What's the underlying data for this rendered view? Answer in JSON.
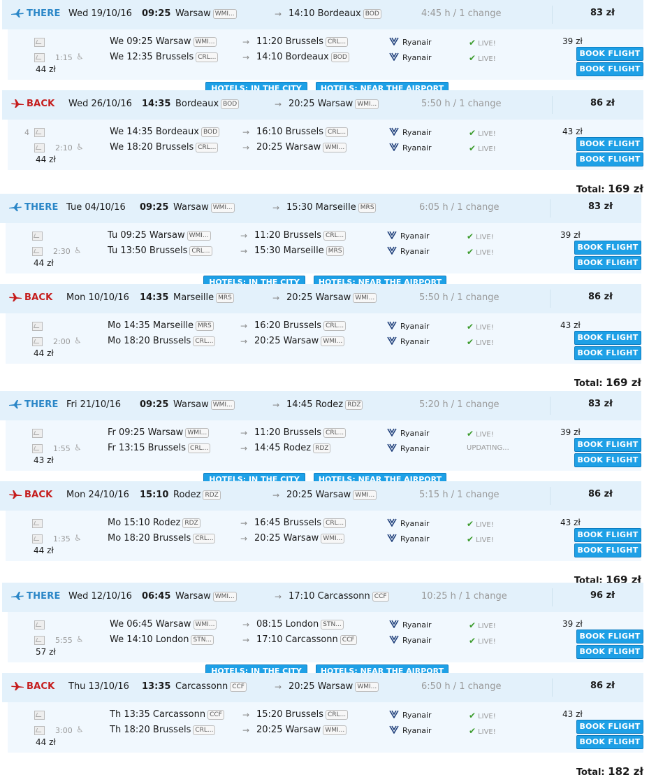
{
  "labels": {
    "there": "THERE",
    "back": "BACK",
    "book": "BOOK FLIGHT",
    "hotels_city": "HOTELS: IN THE CITY",
    "hotels_airport": "HOTELS: NEAR THE AIRPORT",
    "total": "Total:",
    "airline": "Ryanair"
  },
  "colors": {
    "accent": "#1ea0e6",
    "there": "#2a86c7",
    "back": "#c51d1d",
    "bar": "#e3f1fb",
    "live": "#3a9a2a"
  },
  "trips": [
    {
      "there": {
        "date": "Wed 19/10/16",
        "time": "09:25",
        "from": "Warsaw",
        "from_code": "WMI...",
        "arr": "14:10 Bordeaux",
        "arr_code": "BOD",
        "duration": "4:45 h / 1 change",
        "price": "83 zł",
        "seg1": {
          "dep": "We 09:25 Warsaw",
          "dep_code": "WMI...",
          "arr": "11:20 Brussels",
          "arr_code": "CRL...",
          "status": "LIVE!",
          "price": "39 zł"
        },
        "seg2": {
          "dep": "We 12:35 Brussels",
          "dep_code": "CRL...",
          "arr": "14:10 Bordeaux",
          "arr_code": "BOD",
          "status": "LIVE!"
        },
        "layover": "1:15",
        "side_price": "44 zł"
      },
      "back": {
        "date": "Wed 26/10/16",
        "time": "14:35",
        "from": "Bordeaux",
        "from_code": "BOD",
        "arr": "20:25 Warsaw",
        "arr_code": "WMI...",
        "duration": "5:50 h / 1 change",
        "price": "86 zł",
        "seg1": {
          "dep": "We 14:35 Bordeaux",
          "dep_code": "BOD",
          "arr": "16:10 Brussels",
          "arr_code": "CRL...",
          "status": "LIVE!",
          "price": "43 zł"
        },
        "seg2": {
          "dep": "We 18:20 Brussels",
          "dep_code": "CRL...",
          "arr": "20:25 Warsaw",
          "arr_code": "WMI...",
          "status": "LIVE!"
        },
        "layover": "2:10",
        "side_price": "44 zł",
        "extra": "4"
      },
      "total": "169 zł"
    },
    {
      "there": {
        "date": "Tue 04/10/16",
        "time": "09:25",
        "from": "Warsaw",
        "from_code": "WMI...",
        "arr": "15:30 Marseille",
        "arr_code": "MRS",
        "duration": "6:05 h / 1 change",
        "price": "83 zł",
        "seg1": {
          "dep": "Tu 09:25 Warsaw",
          "dep_code": "WMI...",
          "arr": "11:20 Brussels",
          "arr_code": "CRL...",
          "status": "LIVE!",
          "price": "39 zł"
        },
        "seg2": {
          "dep": "Tu 13:50 Brussels",
          "dep_code": "CRL...",
          "arr": "15:30 Marseille",
          "arr_code": "MRS",
          "status": "LIVE!"
        },
        "layover": "2:30",
        "side_price": "44 zł"
      },
      "back": {
        "date": "Mon 10/10/16",
        "time": "14:35",
        "from": "Marseille",
        "from_code": "MRS",
        "arr": "20:25 Warsaw",
        "arr_code": "WMI...",
        "duration": "5:50 h / 1 change",
        "price": "86 zł",
        "seg1": {
          "dep": "Mo 14:35 Marseille",
          "dep_code": "MRS",
          "arr": "16:20 Brussels",
          "arr_code": "CRL...",
          "status": "LIVE!",
          "price": "43 zł"
        },
        "seg2": {
          "dep": "Mo 18:20 Brussels",
          "dep_code": "CRL...",
          "arr": "20:25 Warsaw",
          "arr_code": "WMI...",
          "status": "LIVE!"
        },
        "layover": "2:00",
        "side_price": "44 zł",
        "extra": ""
      },
      "total": "169 zł"
    },
    {
      "there": {
        "date": "Fri 21/10/16",
        "time": "09:25",
        "from": "Warsaw",
        "from_code": "WMI...",
        "arr": "14:45 Rodez",
        "arr_code": "RDZ",
        "duration": "5:20 h / 1 change",
        "price": "83 zł",
        "seg1": {
          "dep": "Fr 09:25 Warsaw",
          "dep_code": "WMI...",
          "arr": "11:20 Brussels",
          "arr_code": "CRL...",
          "status": "LIVE!",
          "price": "39 zł"
        },
        "seg2": {
          "dep": "Fr 13:15 Brussels",
          "dep_code": "CRL...",
          "arr": "14:45 Rodez",
          "arr_code": "RDZ",
          "status": "UPDATING..."
        },
        "layover": "1:55",
        "side_price": "43 zł"
      },
      "back": {
        "date": "Mon 24/10/16",
        "time": "15:10",
        "from": "Rodez",
        "from_code": "RDZ",
        "arr": "20:25 Warsaw",
        "arr_code": "WMI...",
        "duration": "5:15 h / 1 change",
        "price": "86 zł",
        "seg1": {
          "dep": "Mo 15:10 Rodez",
          "dep_code": "RDZ",
          "arr": "16:45 Brussels",
          "arr_code": "CRL...",
          "status": "LIVE!",
          "price": "43 zł"
        },
        "seg2": {
          "dep": "Mo 18:20 Brussels",
          "dep_code": "CRL...",
          "arr": "20:25 Warsaw",
          "arr_code": "WMI...",
          "status": "LIVE!"
        },
        "layover": "1:35",
        "side_price": "44 zł",
        "extra": ""
      },
      "total": "169 zł"
    },
    {
      "there": {
        "date": "Wed 12/10/16",
        "time": "06:45",
        "from": "Warsaw",
        "from_code": "WMI...",
        "arr": "17:10 Carcassonn",
        "arr_code": "CCF",
        "duration": "10:25 h / 1 change",
        "price": "96 zł",
        "seg1": {
          "dep": "We 06:45 Warsaw",
          "dep_code": "WMI...",
          "arr": "08:15 London",
          "arr_code": "STN...",
          "status": "LIVE!",
          "price": "39 zł"
        },
        "seg2": {
          "dep": "We 14:10 London",
          "dep_code": "STN...",
          "arr": "17:10 Carcassonn",
          "arr_code": "CCF",
          "status": "LIVE!"
        },
        "layover": "5:55",
        "side_price": "57 zł"
      },
      "back": {
        "date": "Thu 13/10/16",
        "time": "13:35",
        "from": "Carcassonn",
        "from_code": "CCF",
        "arr": "20:25 Warsaw",
        "arr_code": "WMI...",
        "duration": "6:50 h / 1 change",
        "price": "86 zł",
        "seg1": {
          "dep": "Th 13:35 Carcassonn",
          "dep_code": "CCF",
          "arr": "15:20 Brussels",
          "arr_code": "CRL...",
          "status": "LIVE!",
          "price": "43 zł"
        },
        "seg2": {
          "dep": "Th 18:20 Brussels",
          "dep_code": "CRL...",
          "arr": "20:25 Warsaw",
          "arr_code": "WMI...",
          "status": "LIVE!"
        },
        "layover": "3:00",
        "side_price": "44 zł",
        "extra": ""
      },
      "total": "182 zł"
    }
  ]
}
